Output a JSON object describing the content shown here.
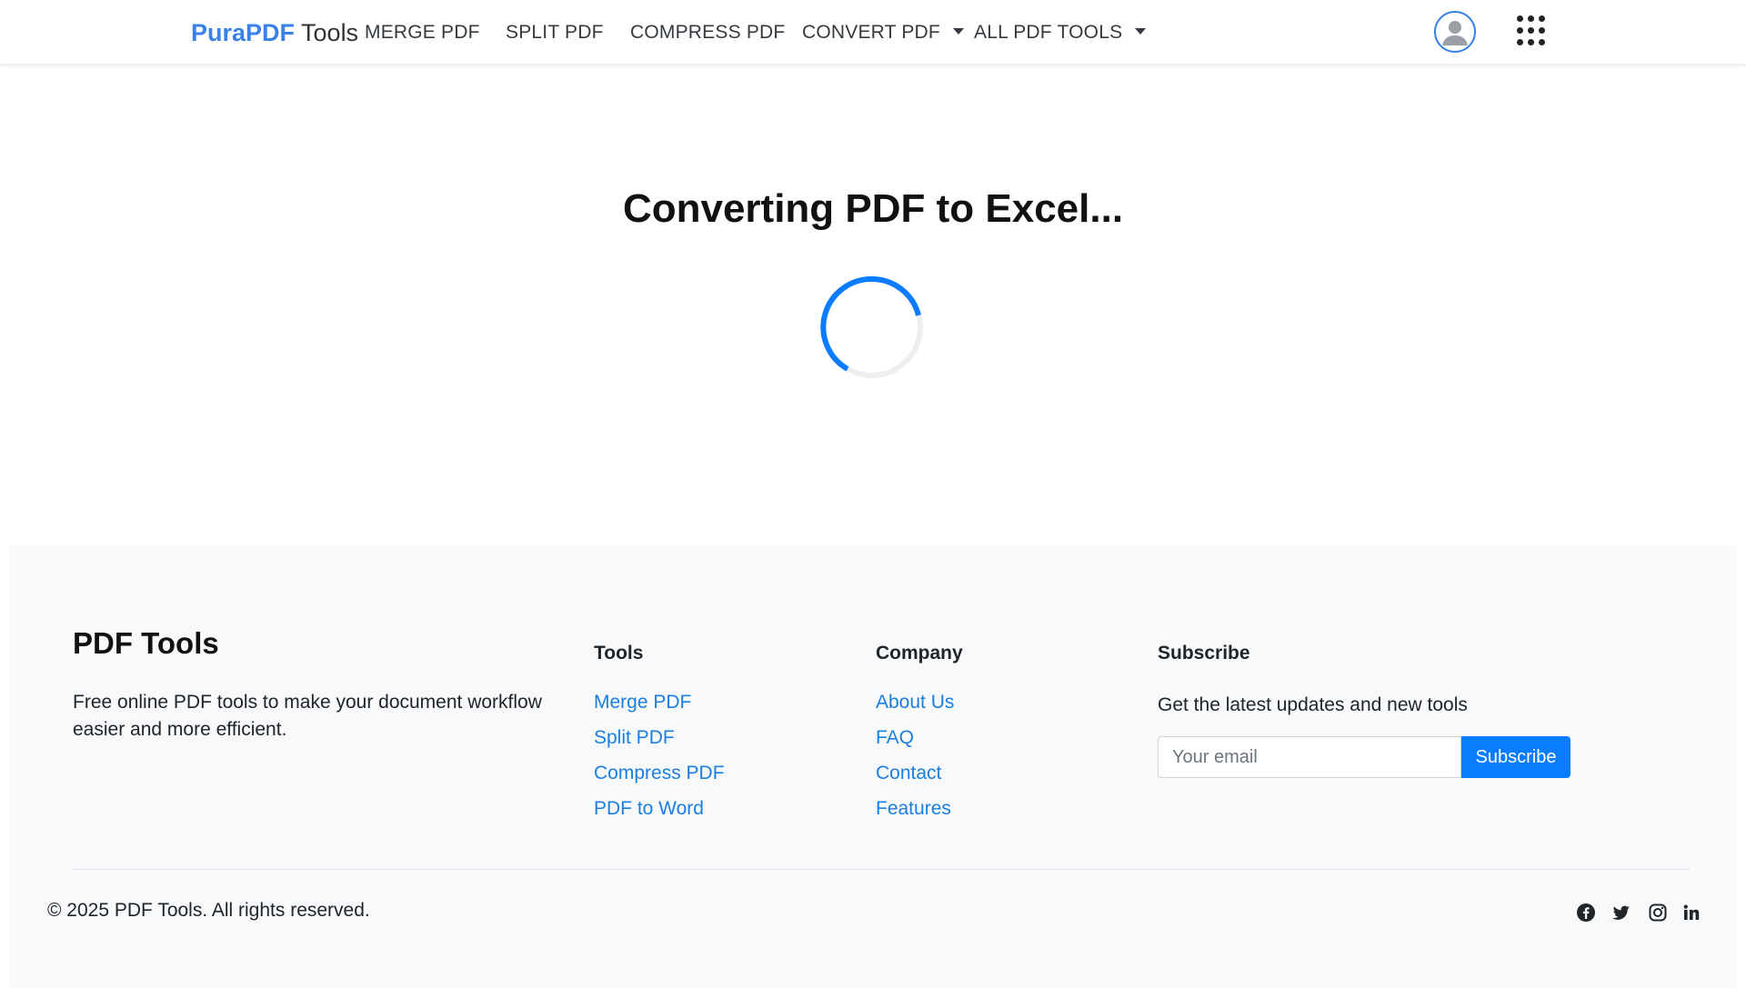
{
  "nav": {
    "brand_primary": "PuraPDF",
    "brand_secondary": "Tools",
    "items": [
      {
        "label": "MERGE PDF"
      },
      {
        "label": "SPLIT PDF"
      },
      {
        "label": "COMPRESS PDF"
      },
      {
        "label": "CONVERT PDF",
        "dropdown": true
      },
      {
        "label": "ALL PDF TOOLS",
        "dropdown": true
      }
    ],
    "avatar_icon": "user-icon",
    "apps_icon": "grid-icon"
  },
  "main": {
    "heading": "Converting PDF to Excel...",
    "spinner_icon": "loading-spinner"
  },
  "footer": {
    "title": "PDF Tools",
    "description": "Free online PDF tools to make your document workflow easier and more efficient.",
    "tools": {
      "heading": "Tools",
      "links": [
        "Merge PDF",
        "Split PDF",
        "Compress PDF",
        "PDF to Word"
      ]
    },
    "company": {
      "heading": "Company",
      "links": [
        "About Us",
        "FAQ",
        "Contact",
        "Features"
      ]
    },
    "subscribe": {
      "heading": "Subscribe",
      "text": "Get the latest updates and new tools",
      "placeholder": "Your email",
      "button": "Subscribe"
    },
    "copyright": "© 2025 PDF Tools. All rights reserved.",
    "social_icons": [
      "facebook-icon",
      "twitter-icon",
      "instagram-icon",
      "linkedin-icon"
    ]
  },
  "colors": {
    "accent": "#0a7cff",
    "brand": "#3b82e8",
    "link": "#1a7fe0",
    "footer_bg": "#f8f9fa"
  }
}
